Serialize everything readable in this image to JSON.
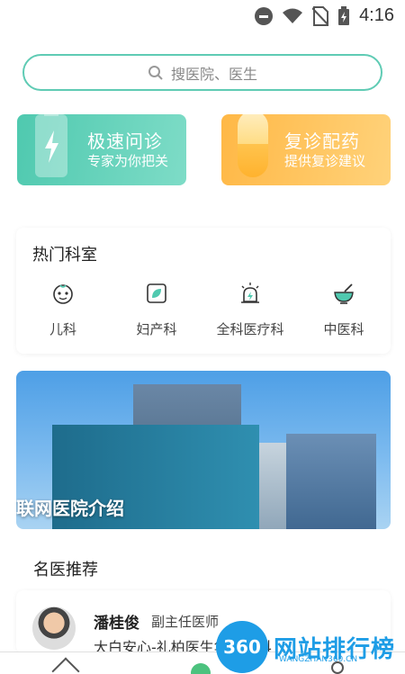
{
  "status_bar": {
    "time": "4:16"
  },
  "search": {
    "placeholder": "搜医院、医生"
  },
  "quick_cards": [
    {
      "title": "极速问诊",
      "subtitle": "专家为你把关",
      "color": "#4fc9af"
    },
    {
      "title": "复诊配药",
      "subtitle": "提供复诊建议",
      "color": "#ffb846"
    }
  ],
  "hot_departments": {
    "title": "热门科室",
    "items": [
      {
        "label": "儿科",
        "icon": "baby-face-icon"
      },
      {
        "label": "妇产科",
        "icon": "leaf-icon"
      },
      {
        "label": "全科医疗科",
        "icon": "alarm-light-icon"
      },
      {
        "label": "中医科",
        "icon": "mortar-bowl-icon"
      }
    ]
  },
  "banner": {
    "text": "联网医院介绍"
  },
  "recommended": {
    "title": "名医推荐",
    "doctor": {
      "name": "潘桂俊",
      "title": "副主任医师",
      "hospital": "大白安心-礼柏医生集团儿科"
    }
  },
  "watermark": {
    "badge": "360",
    "text": "网站排行榜",
    "url": "WANGZHAN360.CN"
  },
  "accent_color": "#5fcbb4"
}
